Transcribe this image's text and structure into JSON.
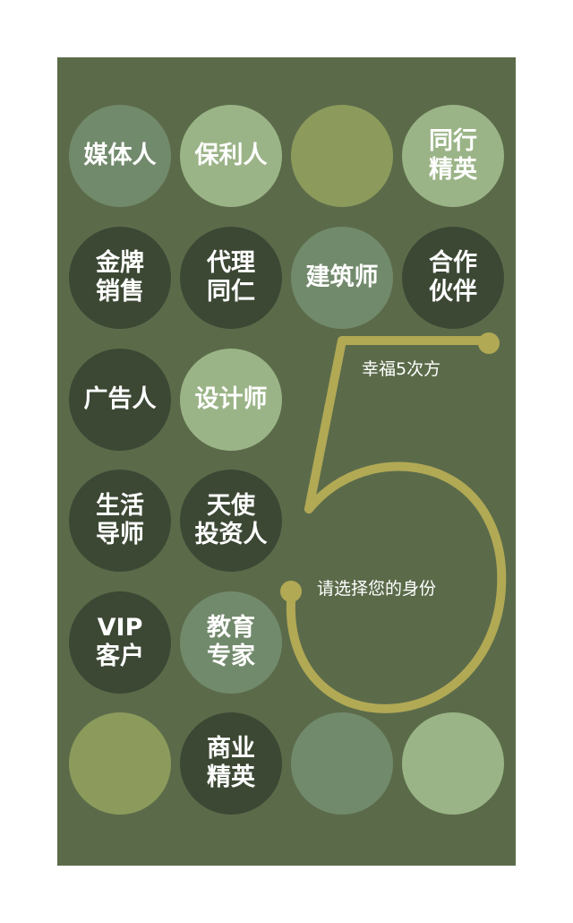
{
  "colors": {
    "panel_bg": "#5b6b4a",
    "circle_mid": "#728a6c",
    "circle_light": "#9bb487",
    "circle_olive": "#8c9b5b",
    "circle_dark": "#3c4834",
    "five_stroke": "#b2a955"
  },
  "slogan": {
    "title": "幸福5次方",
    "subtitle": "请选择您的身份"
  },
  "identities": [
    {
      "label": "媒体人"
    },
    {
      "label": "保利人"
    },
    {
      "label": ""
    },
    {
      "label": "同行\n精英"
    },
    {
      "label": "金牌\n销售"
    },
    {
      "label": "代理\n同仁"
    },
    {
      "label": "建筑师"
    },
    {
      "label": "合作\n伙伴"
    },
    {
      "label": "广告人"
    },
    {
      "label": "设计师"
    },
    {
      "label": "生活\n导师"
    },
    {
      "label": "天使\n投资人"
    },
    {
      "label": "VIP\n客户"
    },
    {
      "label": "教育\n专家"
    },
    {
      "label": ""
    },
    {
      "label": "商业\n精英"
    },
    {
      "label": ""
    },
    {
      "label": ""
    }
  ]
}
